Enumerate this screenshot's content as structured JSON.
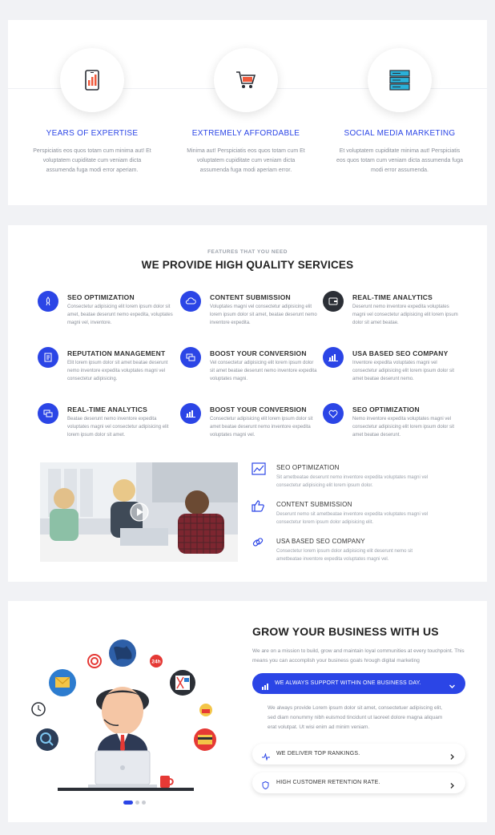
{
  "stats": [
    {
      "icon": "tablet-chart-icon",
      "title": "YEARS OF EXPERTISE",
      "text": "Perspiciatis eos quos totam cum minima aut! Et voluptatem cupiditate cum veniam dicta assumenda fuga modi error aperiam."
    },
    {
      "icon": "shopping-cart-icon",
      "title": "EXTREMELY AFFORDABLE",
      "text": "Minima aut! Perspiciatis eos quos totam cum Et voluptatem cupiditate cum veniam dicta assumenda fuga modi aperiam error."
    },
    {
      "icon": "server-stack-icon",
      "title": "SOCIAL MEDIA MARKETING",
      "text": "Et voluptatem cupiditate minima aut! Perspiciatis eos quos totam cum veniam dicta assumenda fuga modi error assumenda."
    }
  ],
  "services_section": {
    "eyebrow": "FEATURES THAT YOU NEED",
    "title": "WE PROVIDE HIGH QUALITY SERVICES",
    "items": [
      {
        "icon": "rocket-icon",
        "title": "SEO OPTIMIZATION",
        "text": "Consectetur adipisicing elit lorem ipsum dolor sit amet, beatae deserunt nemo expedita, voluptates magni vel, inventore."
      },
      {
        "icon": "cloud-icon",
        "title": "CONTENT SUBMISSION",
        "text": "Voluptates magni vel consectetur adipisicing elit lorem ipsum dolor sit amet, beatae deserunt nemo inventore expedita."
      },
      {
        "icon": "wallet-icon",
        "title": "REAL-TIME ANALYTICS",
        "text": "Deserunt nemo inventore expedita voluptates magni vel consectetur adipisicing elit lorem ipsum dolor sit amet beatae."
      },
      {
        "icon": "document-icon",
        "title": "REPUTATION MANAGEMENT",
        "text": "Elit lorem ipsum dolor sit amet beatae deserunt nemo inventore expedita voluptates magni vel consectetur adipisicing."
      },
      {
        "icon": "chat-icon",
        "title": "BOOST YOUR CONVERSION",
        "text": "Vel consectetur adipisicing elit lorem ipsum dolor sit amet beatae deserunt nemo inventore expedita voluptates magni."
      },
      {
        "icon": "bar-chart-icon",
        "title": "USA BASED SEO COMPANY",
        "text": "Inventore expedita voluptates magni vel consectetur adipisicing elit lorem ipsum dolor sit amet beatae deserunt nemo."
      },
      {
        "icon": "chat-icon",
        "title": "REAL-TIME ANALYTICS",
        "text": "Beatae deserunt nemo inventore expedita voluptates magni vel consectetur adipisicing elit lorem ipsum dolor sit amet."
      },
      {
        "icon": "bar-chart-icon",
        "title": "BOOST YOUR CONVERSION",
        "text": "Consectetur adipisicing elit lorem ipsum dolor sit amet beatae deserunt nemo inventore expedita voluptates magni vel."
      },
      {
        "icon": "heart-icon",
        "title": "SEO OPTIMIZATION",
        "text": "Nemo inventore expedita voluptates magni vel consectetur adipisicing elit lorem ipsum dolor sit amet beatae deserunt."
      }
    ]
  },
  "features": [
    {
      "icon": "area-chart-icon",
      "title": "SEO OPTIMIZATION",
      "text": "Sit ametbeatae deserunt nemo inventore expedita voluptates magni vel consectetur adipisicing elit lorem ipsum dolor."
    },
    {
      "icon": "thumbs-up-icon",
      "title": "CONTENT SUBMISSION",
      "text": "Deserunt nemo sit ametbeatae inventore expedita voluptates magni vel consectetur lorem ipsum dolor adipisicing elit."
    },
    {
      "icon": "link-icon",
      "title": "USA BASED SEO COMPANY",
      "text": "Consectetur lorem ipsum dolor adipisicing elit deserunt nemo sit ametbeatae inventore expedita voluptates magni vel."
    }
  ],
  "grow": {
    "title": "GROW YOUR BUSINESS WITH US",
    "text": "We are on a mission to build, grow and maintain loyal communities at every touchpoint. This means you can accomplish your business goals hrough digital marketing",
    "active": {
      "icon": "chart-icon",
      "label": "WE ALWAYS SUPPORT WITHIN ONE BUSINESS DAY.",
      "body": "We always provide Lorem ipsum dolor sit amet, consectetuer adipiscing elit, sed diam nonummy nibh euismod tincidunt ut laoreet dolore magna aliquam erat volutpat. Ut wisi enim ad minim veniam."
    },
    "items": [
      {
        "icon": "pulse-icon",
        "label": "WE DELIVER TOP RANKINGS."
      },
      {
        "icon": "shield-icon",
        "label": "HIGH CUSTOMER RETENTION RATE."
      }
    ],
    "illus_badge": "24h"
  },
  "colors": {
    "accent": "#2b45e6",
    "dark": "#2b2f36"
  }
}
